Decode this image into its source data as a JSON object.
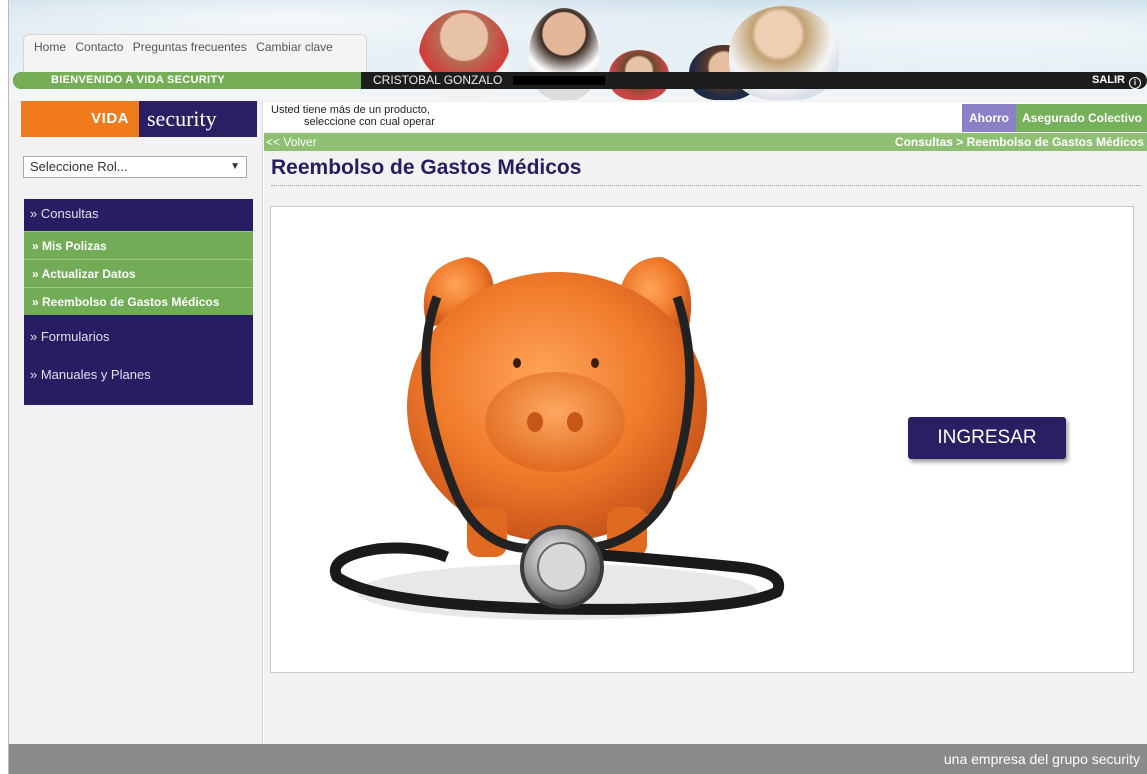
{
  "header": {
    "nav_links": [
      "Home",
      "Contacto",
      "Preguntas frecuentes",
      "Cambiar clave"
    ],
    "welcome": "BIENVENIDO A VIDA SECURITY",
    "user_name": "CRISTOBAL GONZALO",
    "logout": "SALIR"
  },
  "logo": {
    "vida": "VIDA",
    "security": "security"
  },
  "role_select": {
    "value": "Seleccione Rol..."
  },
  "menu": {
    "consultas": "» Consultas",
    "sub_items": [
      "Mis Polizas",
      "Actualizar Datos",
      "Reembolso de Gastos Médicos"
    ],
    "formularios": "» Formularios",
    "manuales": "» Manuales y Planes"
  },
  "product_bar": {
    "line1": "Usted tiene más de un producto,",
    "line2": "seleccione con cual operar",
    "ahorro": "Ahorro",
    "colectivo": "Asegurado Colectivo"
  },
  "green_bar": {
    "back": "<< Volver",
    "breadcrumb": "Consultas > Reembolso de Gastos Médicos"
  },
  "page_title": "Reembolso de Gastos Médicos",
  "ingresar_button": "INGRESAR",
  "footer": "una empresa del grupo security",
  "colors": {
    "purple": "#261d62",
    "green": "#76ae56",
    "orange": "#f07a1c",
    "lavender": "#8b7fc5"
  }
}
